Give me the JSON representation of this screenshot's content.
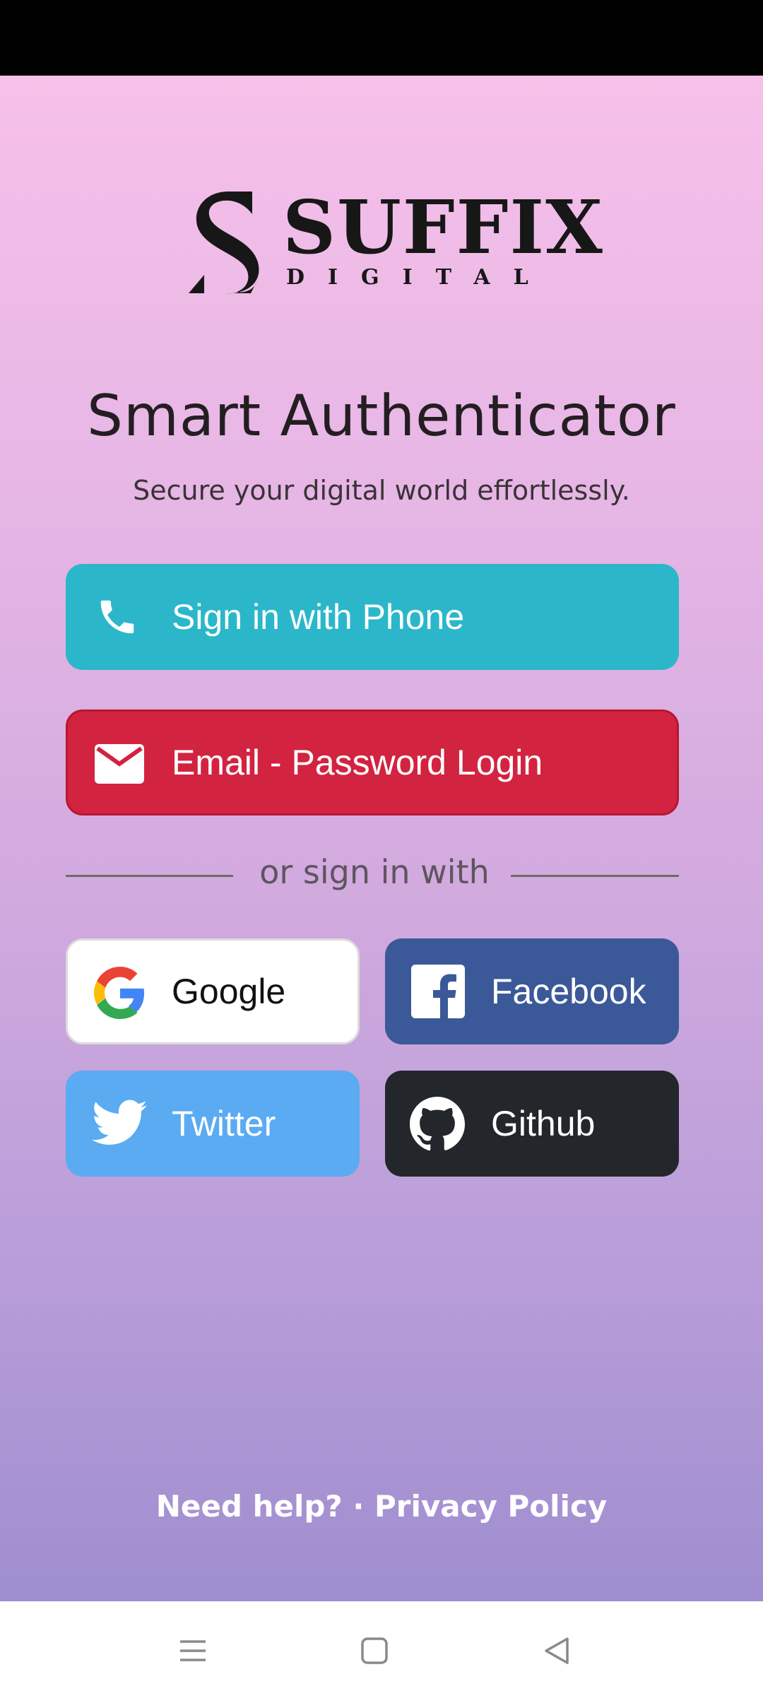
{
  "brand": {
    "name": "SUFFIX",
    "tagline": "DIGITAL"
  },
  "header": {
    "title": "Smart Authenticator",
    "subtitle": "Secure your digital world effortlessly."
  },
  "buttons": {
    "phone": "Sign in with Phone",
    "email": "Email - Password Login"
  },
  "divider": "or sign in with",
  "social": {
    "google": "Google",
    "facebook": "Facebook",
    "twitter": "Twitter",
    "github": "Github"
  },
  "footer": {
    "help": "Need help?",
    "separator": " · ",
    "privacy": "Privacy Policy"
  },
  "icons": {
    "phone": "phone-icon",
    "email": "envelope-icon",
    "google": "google-icon",
    "facebook": "facebook-icon",
    "twitter": "twitter-icon",
    "github": "github-icon",
    "nav_menu": "menu-icon",
    "nav_home": "square-icon",
    "nav_back": "back-triangle-icon"
  },
  "colors": {
    "phone_button": "#2bb7c9",
    "email_button": "#d22340",
    "facebook_button": "#3b5998",
    "twitter_button": "#5aabf2",
    "github_button": "#23272b"
  }
}
